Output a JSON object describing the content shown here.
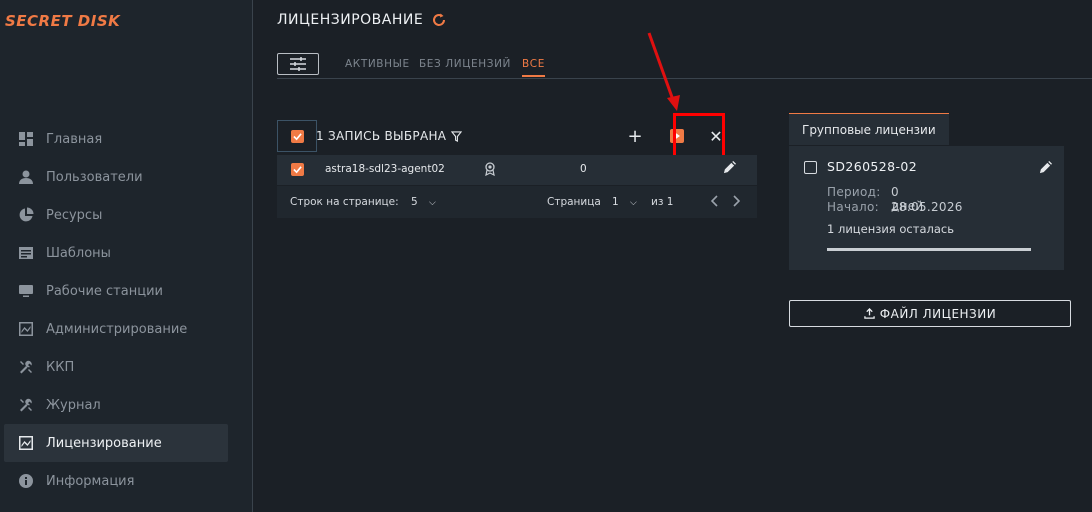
{
  "app": {
    "logo": "SECRET DISK"
  },
  "sidebar": {
    "items": [
      {
        "label": "Главная",
        "icon": "dashboard-icon"
      },
      {
        "label": "Пользователи",
        "icon": "user-icon"
      },
      {
        "label": "Ресурсы",
        "icon": "pie-chart-icon"
      },
      {
        "label": "Шаблоны",
        "icon": "template-icon"
      },
      {
        "label": "Рабочие станции",
        "icon": "monitor-icon"
      },
      {
        "label": "Администрирование",
        "icon": "admin-chart-icon"
      },
      {
        "label": "ККП",
        "icon": "tools-icon"
      },
      {
        "label": "Журнал",
        "icon": "tools-icon"
      },
      {
        "label": "Лицензирование",
        "icon": "license-chart-icon",
        "active": true
      },
      {
        "label": "Информация",
        "icon": "info-icon"
      }
    ]
  },
  "main": {
    "title": "ЛИЦЕНЗИРОВАНИЕ",
    "tabs": [
      {
        "label": "АКТИВНЫЕ"
      },
      {
        "label": "БЕЗ ЛИЦЕНЗИЙ"
      },
      {
        "label": "ВСЕ",
        "active": true
      }
    ]
  },
  "table": {
    "selected_text": "1 ЗАПИСЬ ВЫБРАНА",
    "actions": {
      "add": "+",
      "close": "✕"
    },
    "rows": [
      {
        "name": "astra18-sdl23-agent02",
        "count": "0"
      }
    ],
    "pager": {
      "rows_label": "Строк на странице:",
      "rows_value": "5",
      "page_label": "Страница",
      "page_value": "1",
      "of_label": "из 1"
    }
  },
  "group": {
    "tab_label": "Групповые лицензии",
    "card": {
      "name": "SD260528-02",
      "period_label": "Период:",
      "period_value": "0 дней",
      "start_label": "Начало:",
      "start_value": "28.05.2026",
      "remaining": "1 лицензия осталась"
    },
    "file_button": "ФАЙЛ ЛИЦЕНЗИИ"
  },
  "colors": {
    "accent": "#f07a45",
    "highlight": "#ff0000",
    "background": "#1b2026",
    "panel": "#262e36"
  }
}
